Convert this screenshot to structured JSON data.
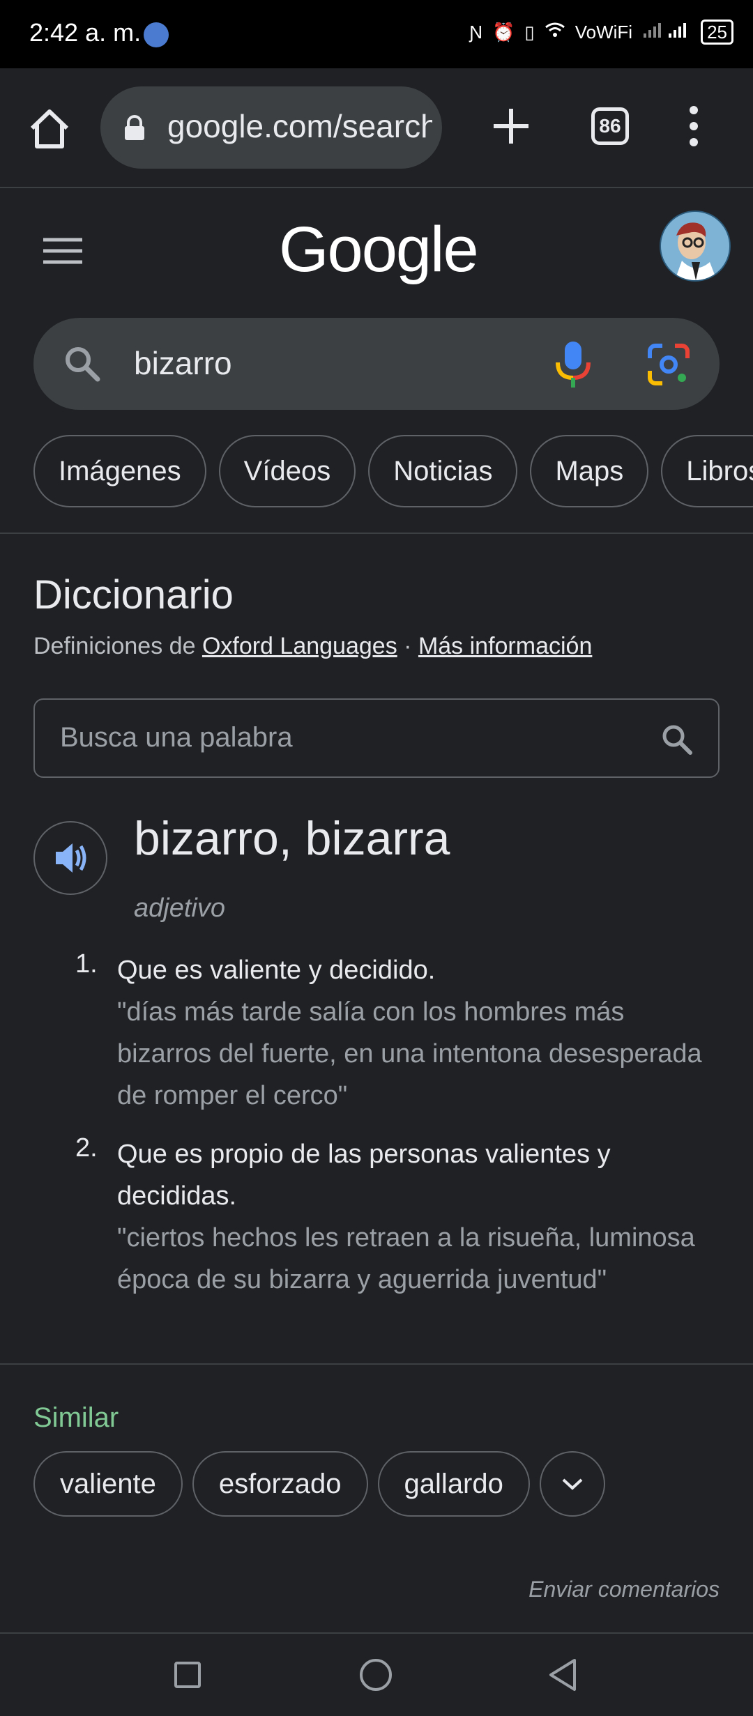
{
  "status_bar": {
    "time": "2:42 a. m.",
    "vowifi": "VoWiFi",
    "battery": "25"
  },
  "browser": {
    "url": "google.com/search?q=bizarro",
    "tab_count": "86"
  },
  "google": {
    "logo": "Google",
    "search_value": "bizarro",
    "chips": [
      "Imágenes",
      "Vídeos",
      "Noticias",
      "Maps",
      "Libros"
    ]
  },
  "dictionary": {
    "title": "Diccionario",
    "source_prefix": "Definiciones de",
    "source_link": "Oxford Languages",
    "separator": "·",
    "more_info": "Más información",
    "search_placeholder": "Busca una palabra",
    "headword": "bizarro, bizarra",
    "part_of_speech": "adjetivo",
    "definitions": [
      {
        "num": "1.",
        "text": "Que es valiente y decidido.",
        "example": "\"días más tarde salía con los hombres más bizarros del fuerte, en una intentona desesperada de romper el cerco\""
      },
      {
        "num": "2.",
        "text": "Que es propio de las personas valientes y decididas.",
        "example": "\"ciertos hechos les retraen a la risueña, luminosa época de su bizarra y aguerrida juventud\""
      }
    ],
    "similar_label": "Similar",
    "similar": [
      "valiente",
      "esforzado",
      "gallardo"
    ],
    "feedback": "Enviar comentarios"
  },
  "colors": {
    "background": "#202124",
    "similar_accent": "#81c995",
    "speaker_blue": "#8ab4f8"
  }
}
